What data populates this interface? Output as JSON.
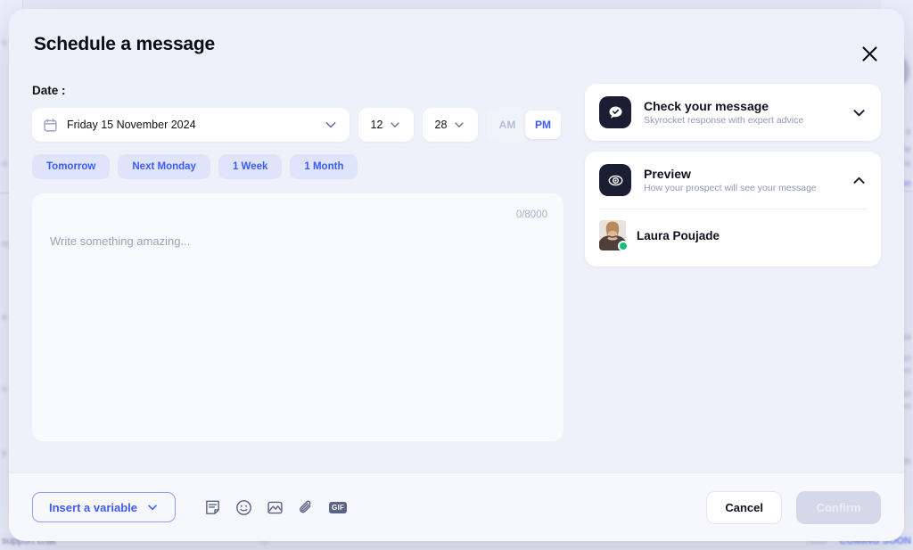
{
  "background": {
    "left_snippets": [
      "s",
      "o",
      "m",
      "e",
      "u",
      "y"
    ],
    "right_snippets": [
      "e",
      "le",
      "fre",
      "in",
      "ala",
      "ano",
      "von",
      "ano",
      "von",
      "nh",
      "ano"
    ],
    "bottom_bar": {
      "left_label": "support chat",
      "note_label": "Note",
      "coming_soon_label": "COMING SOON",
      "coming_soon_color": "#6f86f5"
    }
  },
  "modal": {
    "title": "Schedule a message",
    "close_icon": "close-icon",
    "date": {
      "label": "Date :",
      "calendar_icon": "calendar-icon",
      "value": "Friday 15 November 2024",
      "hour": "12",
      "minute": "28",
      "meridiem_options": [
        "AM",
        "PM"
      ],
      "meridiem_selected": "PM",
      "quick_chips": [
        "Tomorrow",
        "Next Monday",
        "1 Week",
        "1 Month"
      ],
      "chip_text_color": "#3d5afe"
    },
    "composer": {
      "placeholder": "Write something amazing...",
      "counter": "0/8000"
    },
    "panels": [
      {
        "icon": "message-check-icon",
        "title": "Check your message",
        "subtitle": "Skyrocket response with expert advice",
        "expanded": false,
        "chevron": "chevron-down-icon"
      },
      {
        "icon": "eye-preview-icon",
        "title": "Preview",
        "subtitle": "How your prospect will see your message",
        "expanded": true,
        "chevron": "chevron-up-icon",
        "person_name": "Laura Poujade",
        "status_color": "#12c27a"
      }
    ],
    "footer": {
      "insert_variable_label": "Insert a variable",
      "insert_variable_chevron": "chevron-down-icon",
      "tools": [
        "note-icon",
        "emoji-icon",
        "image-icon",
        "attachment-icon",
        "gif-icon"
      ],
      "gif_label": "GIF",
      "cancel_label": "Cancel",
      "confirm_label": "Confirm",
      "confirm_disabled": true
    }
  }
}
